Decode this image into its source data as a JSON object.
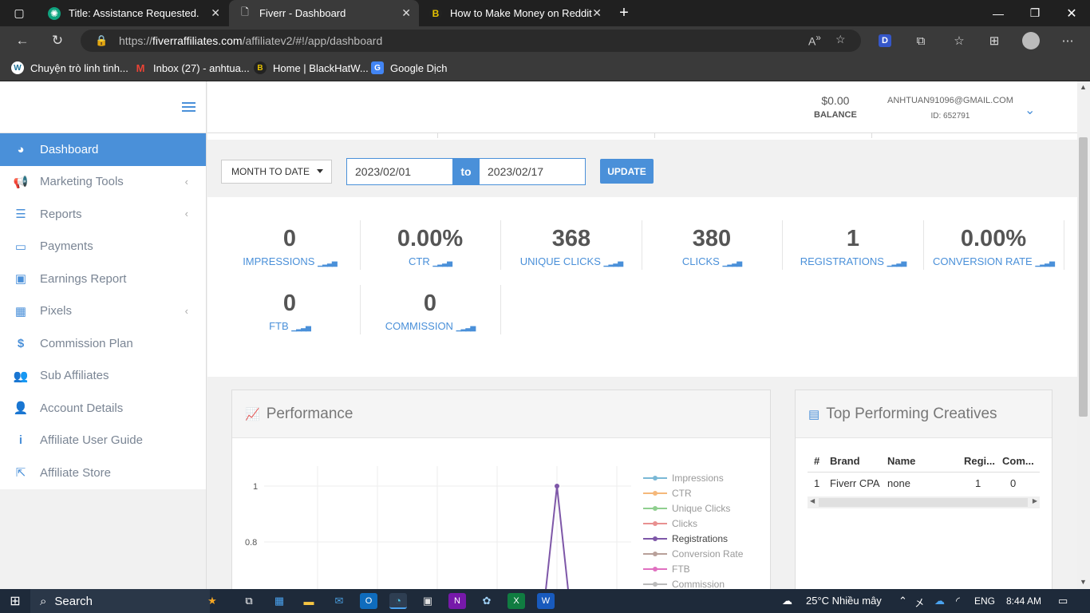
{
  "browser": {
    "tabs": [
      {
        "title": "Title: Assistance Requested.",
        "icon": "chatgpt-icon"
      },
      {
        "title": "Fiverr - Dashboard",
        "icon": "page-icon"
      },
      {
        "title": "How to Make Money on Reddit i",
        "icon": "blackhat-icon"
      }
    ],
    "url_prefix": "https://",
    "url_domain": "fiverraffiliates.com",
    "url_path": "/affiliatev2/#!/app/dashboard",
    "bookmarks": [
      {
        "label": "Chuyện trò linh tinh...",
        "icon": "wordpress-icon"
      },
      {
        "label": "Inbox (27) - anhtua...",
        "icon": "gmail-icon"
      },
      {
        "label": "Home | BlackHatW...",
        "icon": "blackhat-icon"
      },
      {
        "label": "Google Dịch",
        "icon": "google-translate-icon"
      }
    ]
  },
  "sidebar": {
    "items": [
      {
        "label": "Dashboard",
        "icon": "dashboard-icon",
        "active": true
      },
      {
        "label": "Marketing Tools",
        "icon": "megaphone-icon",
        "chevron": true
      },
      {
        "label": "Reports",
        "icon": "list-icon",
        "chevron": true
      },
      {
        "label": "Payments",
        "icon": "credit-card-icon"
      },
      {
        "label": "Earnings Report",
        "icon": "money-icon"
      },
      {
        "label": "Pixels",
        "icon": "grid-icon",
        "chevron": true
      },
      {
        "label": "Commission Plan",
        "icon": "dollar-icon"
      },
      {
        "label": "Sub Affiliates",
        "icon": "users-icon"
      },
      {
        "label": "Account Details",
        "icon": "user-icon"
      },
      {
        "label": "Affiliate User Guide",
        "icon": "info-icon"
      },
      {
        "label": "Affiliate Store",
        "icon": "external-link-icon"
      }
    ]
  },
  "header": {
    "balance_value": "$0.00",
    "balance_label": "BALANCE",
    "email": "ANHTUAN91096@GMAIL.COM",
    "user_id": "ID: 652791"
  },
  "filter": {
    "range_select": "MONTH TO DATE",
    "from_date": "2023/02/01",
    "to_label": "to",
    "to_date": "2023/02/17",
    "update_label": "UPDATE"
  },
  "stats": [
    {
      "value": "0",
      "label": "IMPRESSIONS"
    },
    {
      "value": "0.00%",
      "label": "CTR"
    },
    {
      "value": "368",
      "label": "UNIQUE CLICKS"
    },
    {
      "value": "380",
      "label": "CLICKS"
    },
    {
      "value": "1",
      "label": "REGISTRATIONS"
    },
    {
      "value": "0.00%",
      "label": "CONVERSION RATE"
    },
    {
      "value": "0",
      "label": "FTB"
    },
    {
      "value": "0",
      "label": "COMMISSION"
    }
  ],
  "performance": {
    "title": "Performance",
    "chart_data": {
      "type": "line",
      "yticks": [
        "1",
        "0.8"
      ],
      "series": [
        {
          "name": "Impressions",
          "color": "#7ab8d6"
        },
        {
          "name": "CTR",
          "color": "#f5b87a"
        },
        {
          "name": "Unique Clicks",
          "color": "#8fcf8f"
        },
        {
          "name": "Clicks",
          "color": "#e89090"
        },
        {
          "name": "Registrations",
          "color": "#7e57a8",
          "peak": 1
        },
        {
          "name": "Conversion Rate",
          "color": "#b8a09a"
        },
        {
          "name": "FTB",
          "color": "#e070c0"
        },
        {
          "name": "Commission",
          "color": "#bbbbbb"
        }
      ]
    }
  },
  "creatives": {
    "title": "Top Performing Creatives",
    "columns": [
      "#",
      "Brand",
      "Name",
      "Regi...",
      "Com..."
    ],
    "rows": [
      [
        "1",
        "Fiverr CPA",
        "none",
        "1",
        "0"
      ]
    ]
  },
  "taskbar": {
    "search": "Search",
    "weather": "25°C  Nhiều mây",
    "lang": "ENG",
    "time": "8:44 AM"
  }
}
